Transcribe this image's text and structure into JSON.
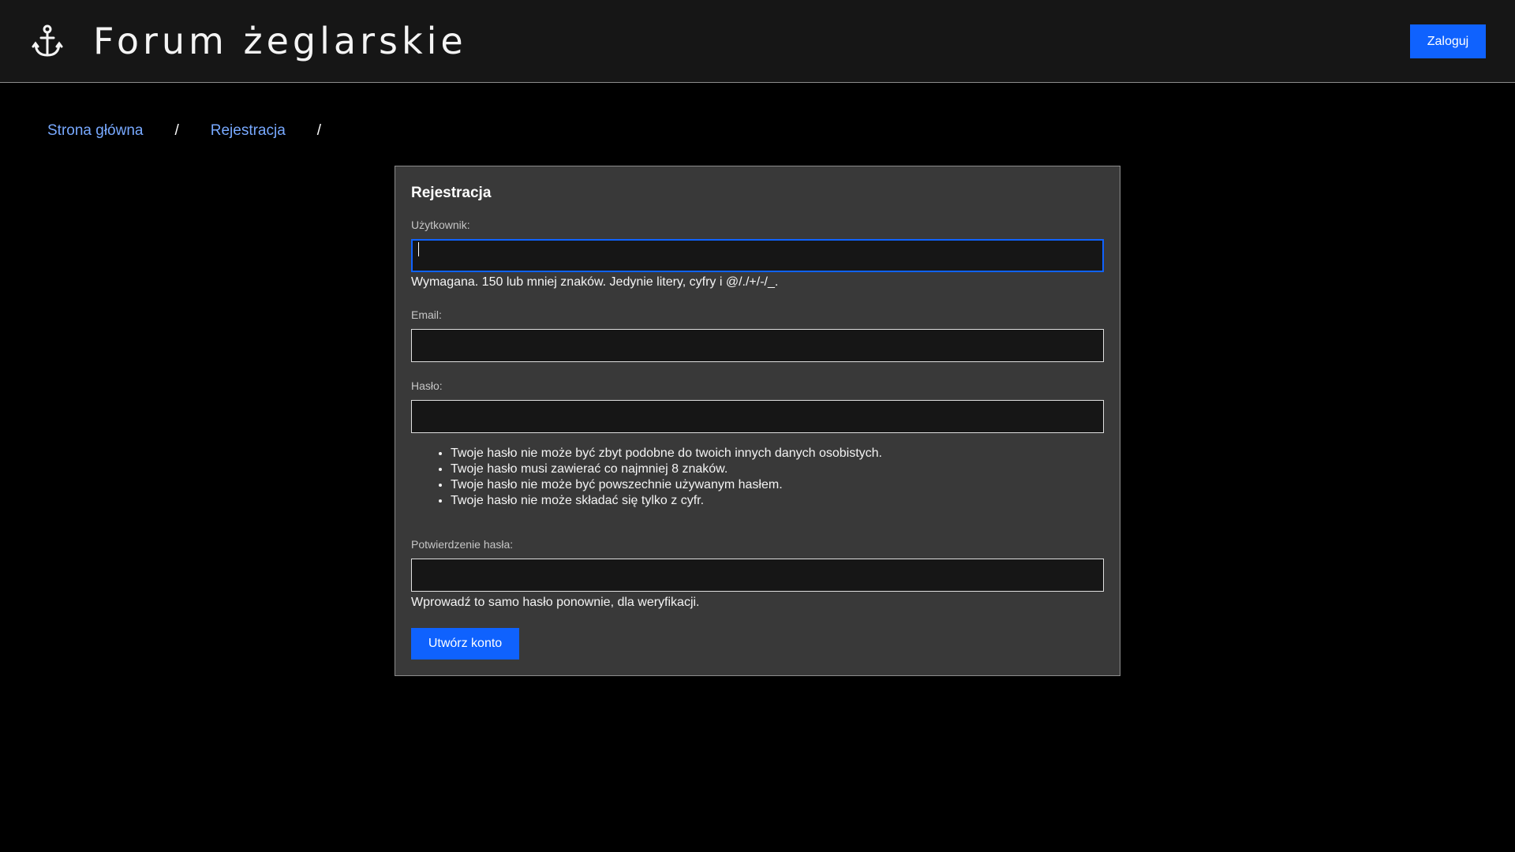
{
  "header": {
    "icon": "anchor-icon",
    "title": "Forum żeglarskie",
    "login_label": "Zaloguj"
  },
  "breadcrumb": {
    "items": [
      "Strona główna",
      "Rejestracja"
    ],
    "separator": "/"
  },
  "form": {
    "title": "Rejestracja",
    "username": {
      "label": "Użytkownik:",
      "value": "",
      "help": "Wymagana. 150 lub mniej znaków. Jedynie litery, cyfry i @/./+/-/_."
    },
    "email": {
      "label": "Email:",
      "value": ""
    },
    "password": {
      "label": "Hasło:",
      "value": "",
      "rules": [
        "Twoje hasło nie może być zbyt podobne do twoich innych danych osobistych.",
        "Twoje hasło musi zawierać co najmniej 8 znaków.",
        "Twoje hasło nie może być powszechnie używanym hasłem.",
        "Twoje hasło nie może składać się tylko z cyfr."
      ]
    },
    "password_confirm": {
      "label": "Potwierdzenie hasła:",
      "value": "",
      "help": "Wprowadź to samo hasło ponownie, dla weryfikacji."
    },
    "submit_label": "Utwórz konto"
  },
  "colors": {
    "accent": "#0f62fe",
    "link": "#78a9ff",
    "header_bg": "#161616",
    "card_bg": "#393939"
  }
}
